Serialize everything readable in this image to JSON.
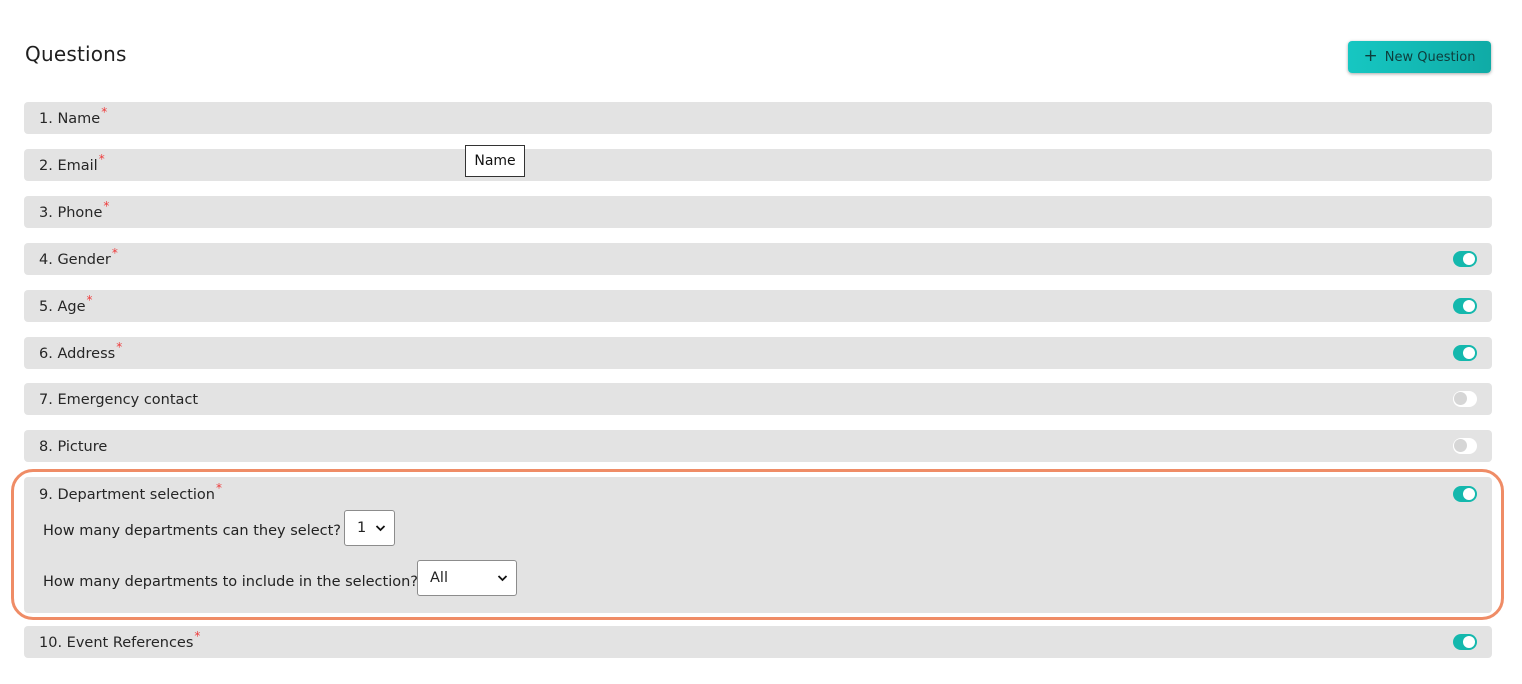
{
  "header": {
    "title": "Questions",
    "new_question_label": "New Question"
  },
  "tooltip": {
    "text": "Name"
  },
  "questions": [
    {
      "label": "1. Name",
      "required": "*"
    },
    {
      "label": "2. Email",
      "required": "*"
    },
    {
      "label": "3. Phone",
      "required": "*"
    },
    {
      "label": "4. Gender",
      "required": "*",
      "enabled": true
    },
    {
      "label": "5. Age",
      "required": "*",
      "enabled": true
    },
    {
      "label": "6. Address",
      "required": "*",
      "enabled": true
    },
    {
      "label": "7. Emergency contact",
      "enabled": false
    },
    {
      "label": "8. Picture",
      "enabled": false
    },
    {
      "label": "9. Department selection",
      "required": "*",
      "enabled": true,
      "select_count_label": "How many departments can they select?",
      "select_count_value": "1",
      "include_label": "How many departments to include in the selection?",
      "include_value": "All"
    },
    {
      "label": "10. Event References",
      "required": "*",
      "enabled": true
    }
  ],
  "colors": {
    "accent": "#14b8ad",
    "row_background": "#e3e3e3",
    "required_marker": "#ee3b3b",
    "highlight_border": "#ef8c66"
  },
  "icons": {
    "new_question": "plus-icon",
    "select": "chevron-down-icon"
  }
}
